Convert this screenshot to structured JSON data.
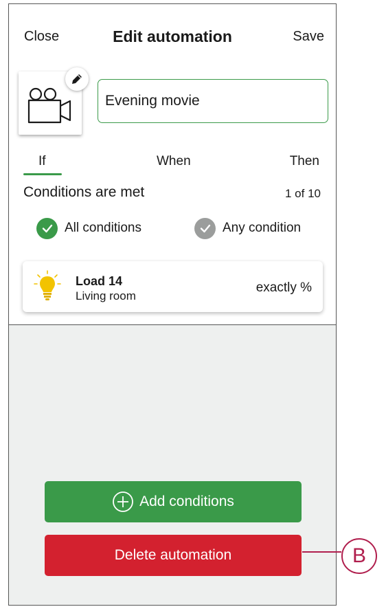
{
  "header": {
    "close_label": "Close",
    "title": "Edit automation",
    "save_label": "Save"
  },
  "automation": {
    "icon": "movie-camera-icon",
    "name": "Evening movie"
  },
  "tabs": [
    {
      "label": "If",
      "active": true
    },
    {
      "label": "When",
      "active": false
    },
    {
      "label": "Then",
      "active": false
    }
  ],
  "conditions": {
    "label": "Conditions are met",
    "count": "1 of 10",
    "options": [
      {
        "label": "All conditions",
        "selected": true
      },
      {
        "label": "Any condition",
        "selected": false
      }
    ]
  },
  "devices": [
    {
      "icon": "lightbulb-icon",
      "name": "Load 14",
      "room": "Living room",
      "value": "exactly %"
    }
  ],
  "buttons": {
    "add_conditions": "Add conditions",
    "delete_automation": "Delete automation"
  },
  "callout": {
    "label": "B"
  },
  "colors": {
    "accent_green": "#3a9a49",
    "danger_red": "#d3212f",
    "callout": "#b01e4d"
  }
}
